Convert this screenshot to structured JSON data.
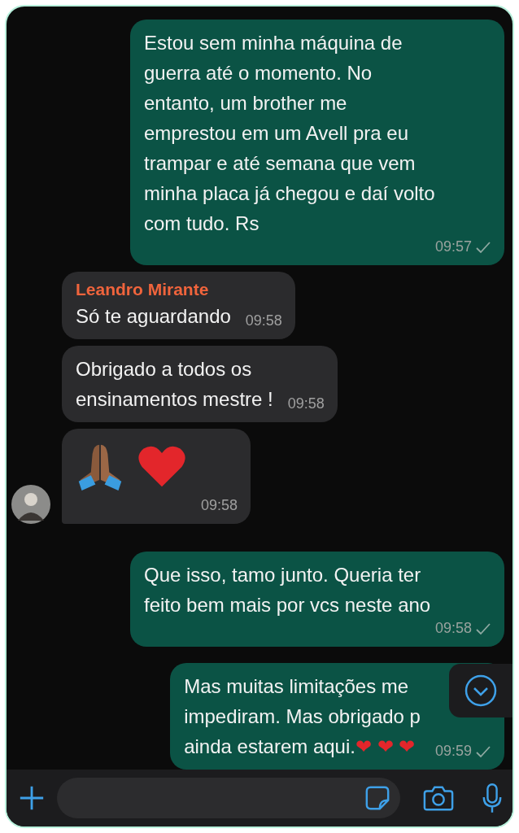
{
  "messages": [
    {
      "kind": "text",
      "outgoing": true,
      "text": "Estou sem minha máquina de\nguerra até o momento. No\nentanto, um brother me\nemprestou em um Avell pra eu\ntrampar e até semana que vem\nminha placa já chegou e daí volto\ncom tudo. Rs",
      "time": "09:57",
      "sent": true
    },
    {
      "kind": "text",
      "outgoing": false,
      "sender": "Leandro Mirante",
      "text": "Só te aguardando",
      "time": "09:58"
    },
    {
      "kind": "text",
      "outgoing": false,
      "text": "Obrigado a todos os\nensinamentos mestre !",
      "time": "09:58"
    },
    {
      "kind": "emoji",
      "outgoing": false,
      "time": "09:58",
      "tail": true
    },
    {
      "kind": "text",
      "outgoing": true,
      "text": "Que isso, tamo junto. Queria ter\nfeito bem mais por vcs neste ano",
      "time": "09:58",
      "sent": true
    },
    {
      "kind": "text",
      "outgoing": true,
      "text": "Mas muitas limitações me\nimpediram. Mas obrigado p\nainda estarem aqui.",
      "emoji": "❤ ❤ ❤",
      "time": "09:59",
      "sent": true
    }
  ]
}
